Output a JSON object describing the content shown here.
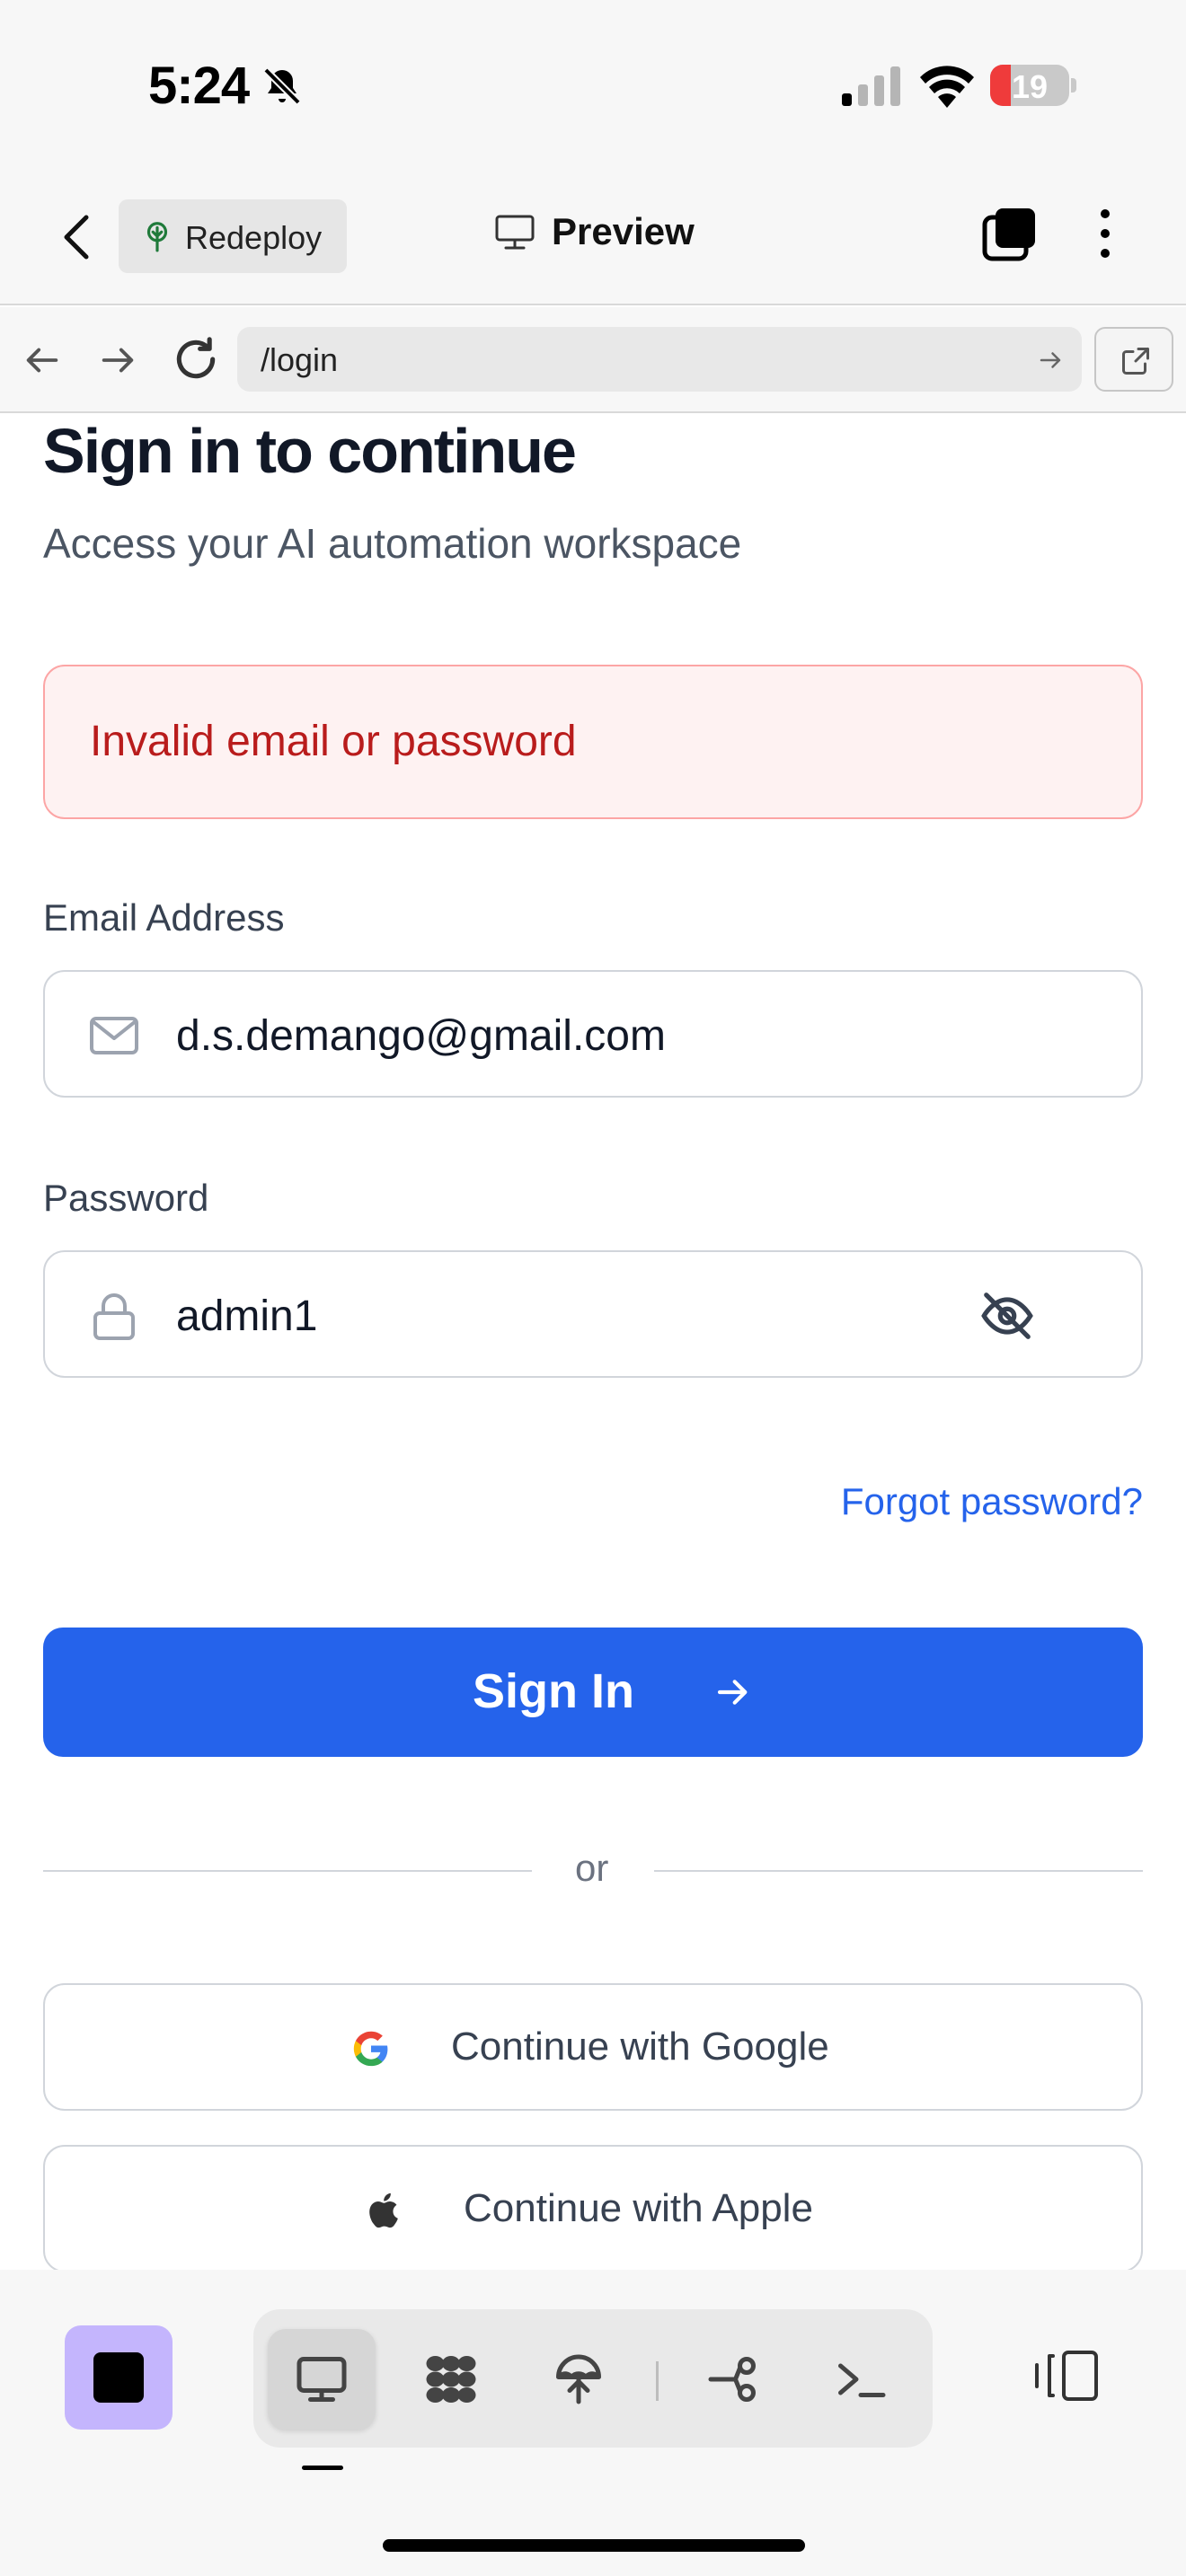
{
  "status_bar": {
    "time": "5:24",
    "battery_percent": "19",
    "battery_level": 0.19,
    "icons": [
      "bell-muted-icon",
      "cellular-signal-icon",
      "wifi-icon",
      "battery-icon"
    ]
  },
  "header": {
    "back_icon": "chevron-left-icon",
    "project_label": "Redeploy",
    "project_icon": "tree-icon",
    "view_label": "Preview",
    "view_icon": "monitor-icon",
    "tabs_icon": "tabs-icon",
    "menu_icon": "more-vertical-icon"
  },
  "url_bar": {
    "path": "/login",
    "back_icon": "arrow-left-icon",
    "forward_icon": "arrow-right-icon",
    "reload_icon": "reload-icon",
    "go_icon": "arrow-right-icon",
    "external_icon": "external-link-icon"
  },
  "login": {
    "title": "Sign in to continue",
    "subtitle": "Access your AI automation workspace",
    "error_message": "Invalid email or password",
    "email_label": "Email Address",
    "email_value": "d.s.demango@gmail.com",
    "password_label": "Password",
    "password_value": "admin1",
    "forgot_link": "Forgot password?",
    "sign_in_button": "Sign In",
    "divider_text": "or",
    "google_button": "Continue with Google",
    "apple_button": "Continue with Apple"
  },
  "colors": {
    "primary": "#2563eb",
    "error_text": "#b91c1c",
    "error_bg": "#fef2f2",
    "error_border": "#fca5a5",
    "stop_button_bg": "#c4b5fd",
    "chat_gradient_start": "#2f56e8",
    "chat_gradient_end": "#7c3aed",
    "battery_low": "#ef3b3b"
  },
  "toolbar": {
    "stop_icon": "stop-icon",
    "tools": [
      "monitor-icon",
      "modules-icon",
      "deploy-icon",
      "workflow-icon",
      "terminal-icon"
    ],
    "active_tool": "monitor-icon",
    "layout_icon": "split-layout-icon"
  },
  "chat_fab_icon": "chat-bubble-icon"
}
